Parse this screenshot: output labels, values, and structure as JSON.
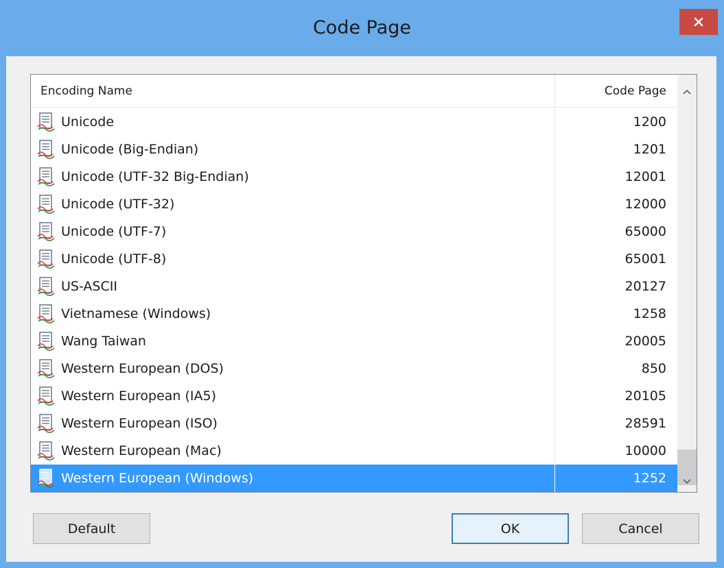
{
  "window": {
    "title": "Code Page",
    "close_label": "✕"
  },
  "list": {
    "columns": {
      "name": "Encoding Name",
      "code": "Code Page"
    },
    "rows": [
      {
        "name": "Unicode",
        "code": "1200",
        "selected": false
      },
      {
        "name": "Unicode (Big-Endian)",
        "code": "1201",
        "selected": false
      },
      {
        "name": "Unicode (UTF-32 Big-Endian)",
        "code": "12001",
        "selected": false
      },
      {
        "name": "Unicode (UTF-32)",
        "code": "12000",
        "selected": false
      },
      {
        "name": "Unicode (UTF-7)",
        "code": "65000",
        "selected": false
      },
      {
        "name": "Unicode (UTF-8)",
        "code": "65001",
        "selected": false
      },
      {
        "name": "US-ASCII",
        "code": "20127",
        "selected": false
      },
      {
        "name": "Vietnamese (Windows)",
        "code": "1258",
        "selected": false
      },
      {
        "name": "Wang Taiwan",
        "code": "20005",
        "selected": false
      },
      {
        "name": "Western European (DOS)",
        "code": "850",
        "selected": false
      },
      {
        "name": "Western European (IA5)",
        "code": "20105",
        "selected": false
      },
      {
        "name": "Western European (ISO)",
        "code": "28591",
        "selected": false
      },
      {
        "name": "Western European (Mac)",
        "code": "10000",
        "selected": false
      },
      {
        "name": "Western European (Windows)",
        "code": "1252",
        "selected": true
      }
    ],
    "row_icon": "encoding-document-icon"
  },
  "buttons": {
    "default_label": "Default",
    "ok_label": "OK",
    "cancel_label": "Cancel"
  },
  "colors": {
    "titlebar": "#6aabe9",
    "close": "#c94a44",
    "selection": "#3399ff"
  }
}
